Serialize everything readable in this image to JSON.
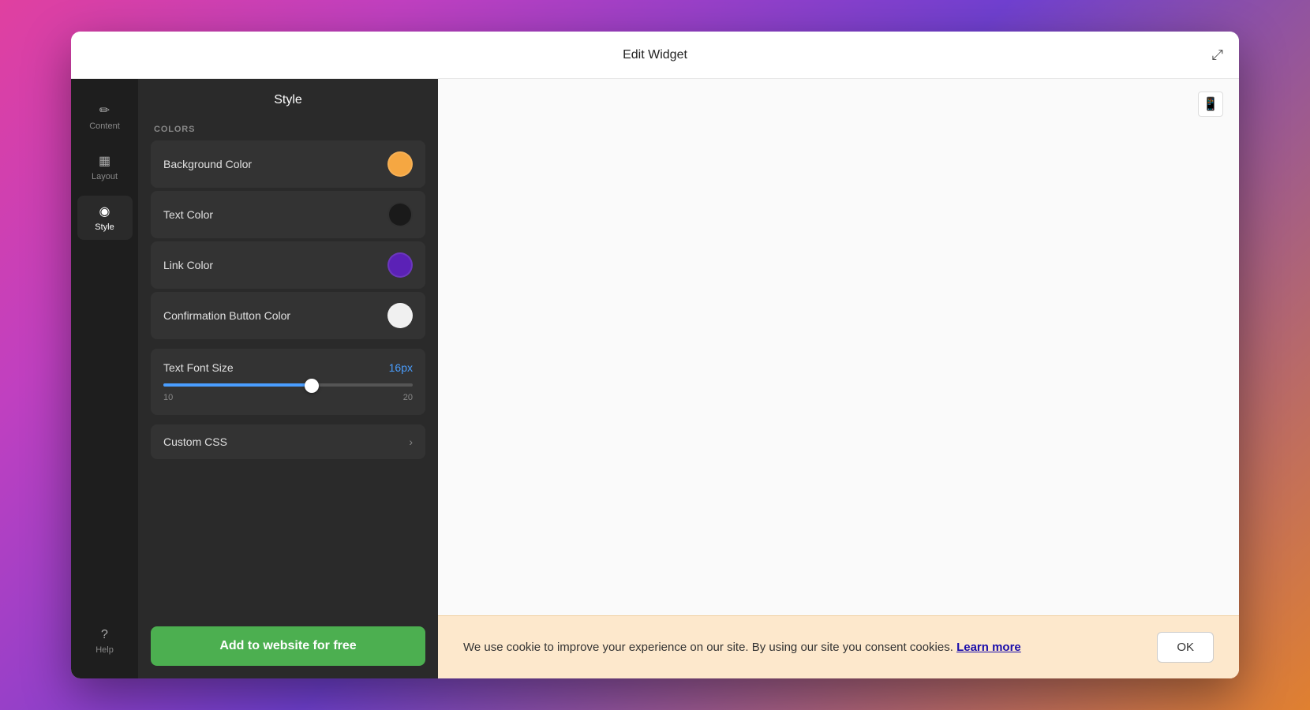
{
  "modal": {
    "title": "Edit Widget",
    "expand_icon": "⤢"
  },
  "sidebar": {
    "items": [
      {
        "id": "content",
        "label": "Content",
        "icon": "✏️",
        "active": false
      },
      {
        "id": "layout",
        "label": "Layout",
        "icon": "⊞",
        "active": false
      },
      {
        "id": "style",
        "label": "Style",
        "icon": "🎨",
        "active": true
      }
    ],
    "help": {
      "label": "Help",
      "icon": "?"
    }
  },
  "style_panel": {
    "header": "Style",
    "colors_section_label": "COLORS",
    "colors": [
      {
        "id": "background-color",
        "label": "Background Color",
        "value": "#f5a742"
      },
      {
        "id": "text-color",
        "label": "Text Color",
        "value": "#1a1a1a"
      },
      {
        "id": "link-color",
        "label": "Link Color",
        "value": "#5b21b6"
      },
      {
        "id": "confirmation-button-color",
        "label": "Confirmation Button Color",
        "value": "#f0f0f0"
      }
    ],
    "font_size": {
      "label": "Text Font Size",
      "value": "16px",
      "min": 10,
      "max": 20,
      "current": 16,
      "slider_percent": 65
    },
    "custom_css": {
      "label": "Custom CSS"
    },
    "add_button": "Add to website for free"
  },
  "cookie_banner": {
    "text": "We use cookie to improve your experience on our site. By using our site you consent cookies.",
    "link_text": "Learn more",
    "ok_button": "OK"
  },
  "preview": {
    "device_icon": "📱"
  }
}
